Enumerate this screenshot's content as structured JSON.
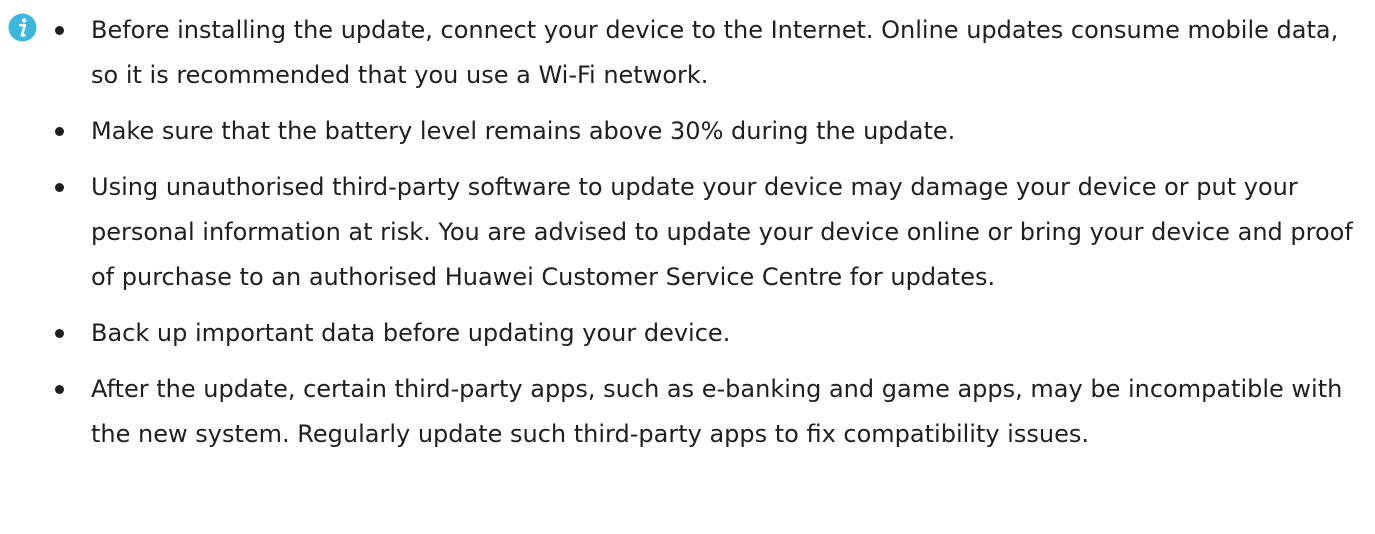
{
  "note": {
    "icon": "info-icon",
    "icon_color": "#3cb8df",
    "text_color": "#1f1f1f",
    "items": [
      {
        "text": "Before installing the update, connect your device to the Internet. Online updates consume mobile data, so it is recommended that you use a Wi-Fi network."
      },
      {
        "text": "Make sure that the battery level remains above 30% during the update."
      },
      {
        "text": "Using unauthorised third-party software to update your device may damage your device or put your personal information at risk. You are advised to update your device online or bring your device and proof of purchase to an authorised Huawei Customer Service Centre for updates."
      },
      {
        "text": "Back up important data before updating your device."
      },
      {
        "text": "After the update, certain third-party apps, such as e-banking and game apps, may be incompatible with the new system. Regularly update such third-party apps to fix compatibility issues."
      }
    ]
  }
}
